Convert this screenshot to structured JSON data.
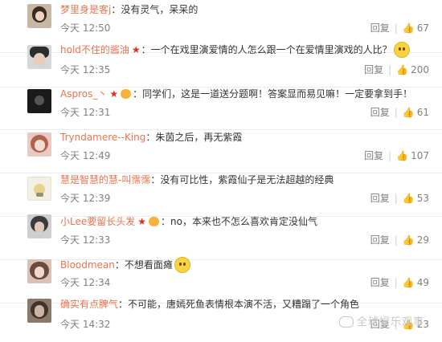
{
  "comments": [
    {
      "user": "梦里身是客j",
      "text": "：没有灵气，呆呆的",
      "time": "今天 12:50",
      "reply": "回复",
      "likes": "67",
      "user_color": "#eb7350",
      "badges": []
    },
    {
      "user": "hold不住的酱油",
      "text": "：一个在戏里演爱情的人怎么跟一个在爱情里演戏的人比？",
      "time": "今天 12:35",
      "reply": "回复",
      "likes": "200",
      "user_color": "#eb7350",
      "badges": [
        "star"
      ],
      "emoji": "sweat-smile-emoji"
    },
    {
      "user": "Aspros_丶",
      "text": "：同学们，这是一道送分题啊！答案显而易见嘛！一定要拿到手！",
      "time": "今天 12:31",
      "reply": "回复",
      "likes": "61",
      "user_color": "#eb7350",
      "badges": [
        "star",
        "vip"
      ]
    },
    {
      "user": "Tryndamere--King",
      "text": "：朱茵之后，再无紫霞",
      "time": "今天 12:49",
      "reply": "回复",
      "likes": "107",
      "user_color": "#eb7350",
      "badges": []
    },
    {
      "user": "慧是智慧的慧-叫霈霈",
      "text": "：没有可比性，紫霞仙子是无法超越的经典",
      "time": "今天 12:39",
      "reply": "回复",
      "likes": "53",
      "user_color": "#eb7350",
      "badges": []
    },
    {
      "user": "小Lee要留长头发",
      "text": "：no，本来也不怎么喜欢肯定没仙气",
      "time": "今天 12:33",
      "reply": "回复",
      "likes": "29",
      "user_color": "#eb7350",
      "badges": [
        "star",
        "vip"
      ]
    },
    {
      "user": "Bloodmean",
      "text": "：不想看面瘫",
      "time": "今天 12:34",
      "reply": "回复",
      "likes": "49",
      "user_color": "#eb7350",
      "badges": [],
      "emoji": "smirk-emoji"
    },
    {
      "user": "确实有点脾气",
      "text": "：不可能，唐嫣死鱼表情根本演不活，又糟蹋了一个角色",
      "time": "今天 14:32",
      "reply": "回复",
      "likes": "23",
      "user_color": "#eb7350",
      "badges": []
    }
  ],
  "like_icon": "thumbs-up-icon",
  "watermark": "全球娱乐观事"
}
